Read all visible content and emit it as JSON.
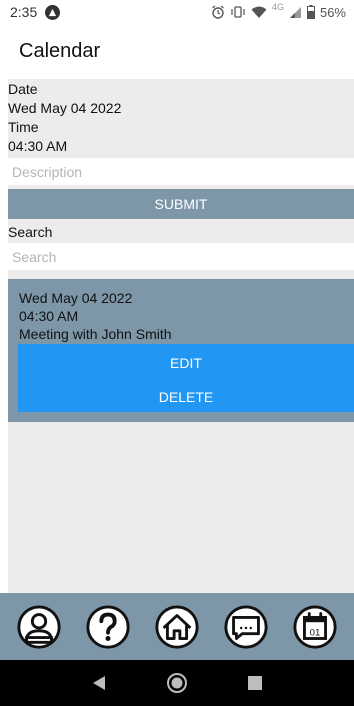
{
  "status_bar": {
    "time": "2:35",
    "battery": "56%",
    "network": "4G"
  },
  "app": {
    "title": "Calendar"
  },
  "form": {
    "date_label": "Date",
    "date_value": "Wed May 04 2022",
    "time_label": "Time",
    "time_value": "04:30 AM",
    "description_placeholder": "Description",
    "description_value": "",
    "submit_label": "SUBMIT",
    "search_label": "Search",
    "search_placeholder": "Search",
    "search_value": ""
  },
  "events": [
    {
      "date": "Wed May 04 2022",
      "time": "04:30 AM",
      "description": "Meeting with John Smith",
      "edit_label": "EDIT",
      "delete_label": "DELETE"
    }
  ],
  "bottom_nav": {
    "items": [
      {
        "icon": "user-icon"
      },
      {
        "icon": "help-icon"
      },
      {
        "icon": "home-icon"
      },
      {
        "icon": "chat-icon"
      },
      {
        "icon": "calendar-icon",
        "badge": "01"
      }
    ]
  },
  "colors": {
    "primary_bar": "#7d97a8",
    "button_blue": "#2196f3",
    "panel_gray": "#ececec"
  }
}
